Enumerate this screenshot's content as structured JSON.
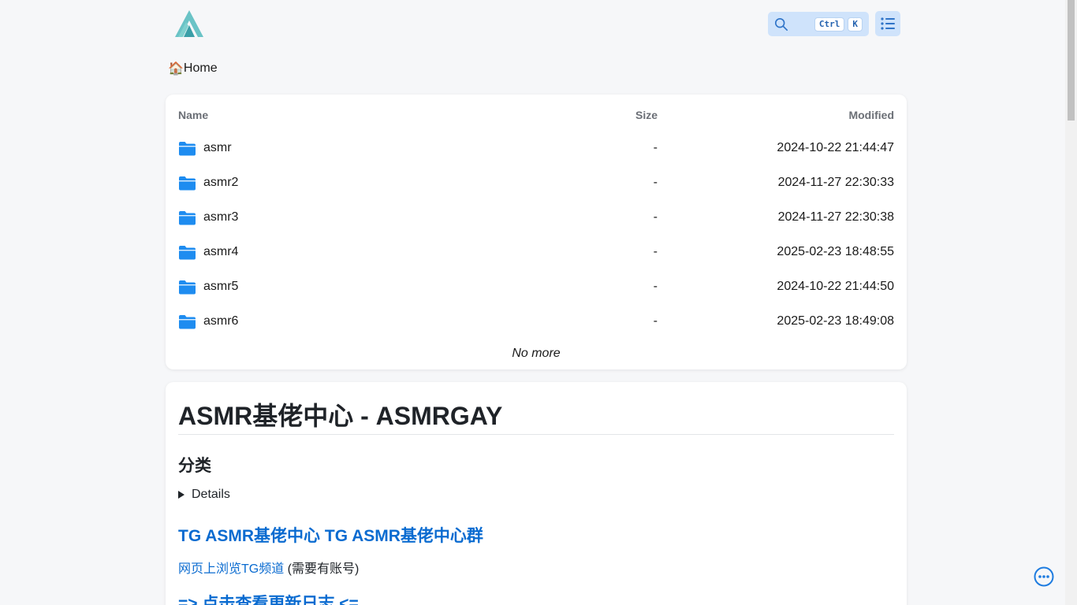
{
  "header": {
    "search": {
      "kbd_ctrl": "Ctrl",
      "kbd_k": "K"
    }
  },
  "breadcrumb": {
    "icon": "🏠",
    "label": "Home"
  },
  "file_list": {
    "columns": {
      "name": "Name",
      "size": "Size",
      "modified": "Modified"
    },
    "rows": [
      {
        "name": "asmr",
        "size": "-",
        "modified": "2024-10-22 21:44:47"
      },
      {
        "name": "asmr2",
        "size": "-",
        "modified": "2024-11-27 22:30:33"
      },
      {
        "name": "asmr3",
        "size": "-",
        "modified": "2024-11-27 22:30:38"
      },
      {
        "name": "asmr4",
        "size": "-",
        "modified": "2025-02-23 18:48:55"
      },
      {
        "name": "asmr5",
        "size": "-",
        "modified": "2024-10-22 21:44:50"
      },
      {
        "name": "asmr6",
        "size": "-",
        "modified": "2025-02-23 18:49:08"
      }
    ],
    "footer": "No more"
  },
  "readme": {
    "title": "ASMR基佬中心 - ASMRGAY",
    "section_heading": "分类",
    "details_label": "Details",
    "tg_heading": "TG ASMR基佬中心 TG ASMR基佬中心群",
    "web_link": "网页上浏览TG频道",
    "web_note": " (需要有账号)",
    "changelog_link": "=> 点击查看更新日志 <="
  },
  "colors": {
    "accent": "#0a6bd0",
    "folder": "#1e8cf0",
    "logo": "#5bbcc0",
    "background": "#f6f7f9"
  }
}
